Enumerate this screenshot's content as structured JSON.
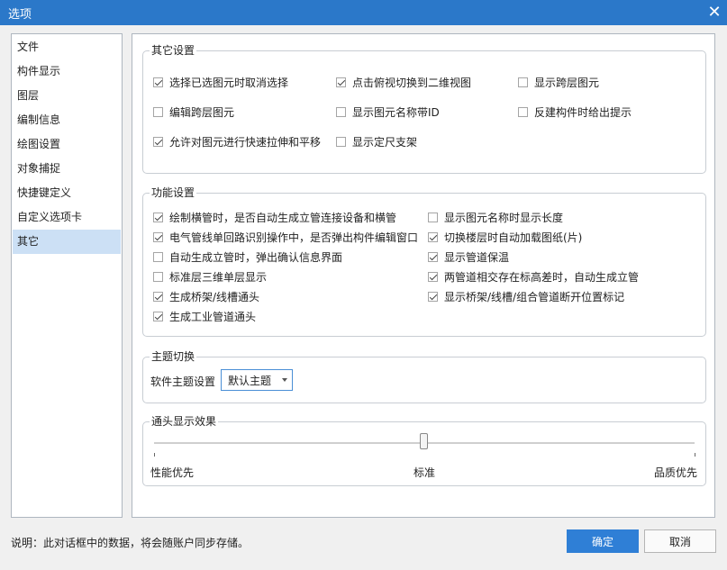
{
  "window": {
    "title": "选项",
    "close_glyph": "✕"
  },
  "sidebar": {
    "items": [
      {
        "label": "文件",
        "selected": false
      },
      {
        "label": "构件显示",
        "selected": false
      },
      {
        "label": "图层",
        "selected": false
      },
      {
        "label": "编制信息",
        "selected": false
      },
      {
        "label": "绘图设置",
        "selected": false
      },
      {
        "label": "对象捕捉",
        "selected": false
      },
      {
        "label": "快捷键定义",
        "selected": false
      },
      {
        "label": "自定义选项卡",
        "selected": false
      },
      {
        "label": "其它",
        "selected": true
      }
    ]
  },
  "other_settings": {
    "title": "其它设置",
    "options": [
      {
        "label": "选择已选图元时取消选择",
        "checked": true
      },
      {
        "label": "点击俯视切换到二维视图",
        "checked": true
      },
      {
        "label": "显示跨层图元",
        "checked": false
      },
      {
        "label": "编辑跨层图元",
        "checked": false
      },
      {
        "label": "显示图元名称带ID",
        "checked": false
      },
      {
        "label": "反建构件时给出提示",
        "checked": false
      },
      {
        "label": "允许对图元进行快速拉伸和平移",
        "checked": true
      },
      {
        "label": "显示定尺支架",
        "checked": false
      }
    ]
  },
  "function_settings": {
    "title": "功能设置",
    "options": [
      {
        "label": "绘制横管时，是否自动生成立管连接设备和横管",
        "checked": true
      },
      {
        "label": "显示图元名称时显示长度",
        "checked": false
      },
      {
        "label": "电气管线单回路识别操作中，是否弹出构件编辑窗口",
        "checked": true
      },
      {
        "label": "切换楼层时自动加载图纸(片)",
        "checked": true
      },
      {
        "label": "自动生成立管时，弹出确认信息界面",
        "checked": false
      },
      {
        "label": "显示管道保温",
        "checked": true
      },
      {
        "label": "标准层三维单层显示",
        "checked": false
      },
      {
        "label": "两管道相交存在标高差时，自动生成立管",
        "checked": true
      },
      {
        "label": "生成桥架/线槽通头",
        "checked": true
      },
      {
        "label": "显示桥架/线槽/组合管道断开位置标记",
        "checked": true
      },
      {
        "label": "生成工业管道通头",
        "checked": true
      }
    ]
  },
  "theme": {
    "title": "主题切换",
    "label": "软件主题设置",
    "selected": "默认主题"
  },
  "fitting_display": {
    "title": "通头显示效果",
    "labels": {
      "left": "性能优先",
      "middle": "标准",
      "right": "品质优先"
    },
    "value_fraction": 0.5
  },
  "footer": {
    "note": "说明：此对话框中的数据，将会随账户同步存储。",
    "ok_label": "确定",
    "cancel_label": "取消"
  },
  "colors": {
    "accent": "#2b78c9",
    "selected_bg": "#cce0f5",
    "primary_button": "#2f7fd6"
  }
}
